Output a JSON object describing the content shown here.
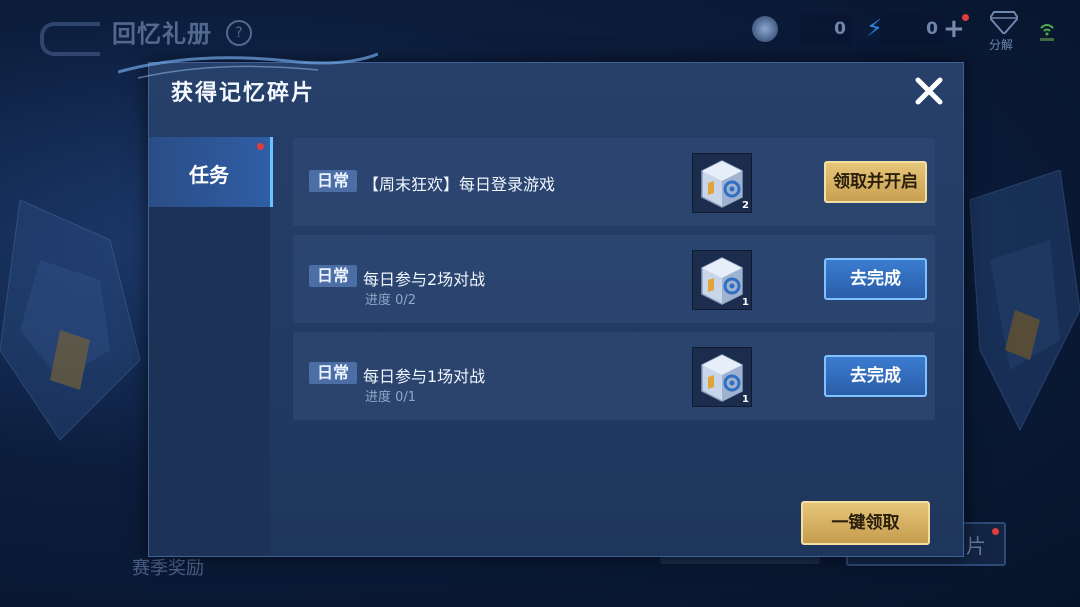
{
  "background": {
    "title": "回忆礼册",
    "help": "?",
    "subtitle": "ᅠ",
    "currency_a": "0",
    "currency_b": "0",
    "decompose_label": "分解",
    "season_label": "赛季奖励",
    "right_button_label": "片"
  },
  "modal": {
    "title": "获得记忆碎片",
    "close_icon": "close-icon",
    "tabs": [
      {
        "label": "任务",
        "active": true,
        "has_notification": true
      }
    ],
    "tasks": [
      {
        "tag": "日常",
        "name": "【周末狂欢】每日登录游戏",
        "progress": "",
        "reward_icon": "memory-box-icon",
        "reward_count": "2",
        "button": "领取并开启",
        "button_style": "gold"
      },
      {
        "tag": "日常",
        "name": "每日参与2场对战",
        "progress": "进度 0/2",
        "reward_icon": "memory-box-icon",
        "reward_count": "1",
        "button": "去完成",
        "button_style": "blue"
      },
      {
        "tag": "日常",
        "name": "每日参与1场对战",
        "progress": "进度 0/1",
        "reward_icon": "memory-box-icon",
        "reward_count": "1",
        "button": "去完成",
        "button_style": "blue"
      }
    ],
    "claim_all_label": "一键领取"
  },
  "colors": {
    "accent_gold": "#d9b565",
    "accent_blue": "#3b7cd0",
    "panel": "#26406a",
    "notification": "#e23b3b"
  }
}
